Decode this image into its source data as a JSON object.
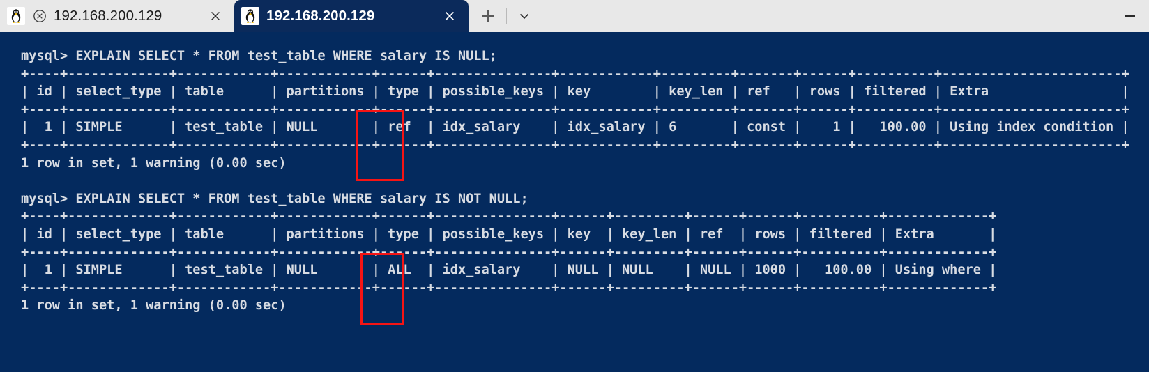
{
  "window": {
    "minimize_label": "Minimize"
  },
  "tabs": [
    {
      "title": "192.168.200.129",
      "active": false,
      "icon": "tux-penguin-icon",
      "status_icon": "circled-x-icon",
      "close_label": "Close tab"
    },
    {
      "title": "192.168.200.129",
      "active": true,
      "icon": "tux-penguin-icon",
      "close_label": "Close tab"
    }
  ],
  "tabbar": {
    "new_tab_label": "New tab",
    "dropdown_label": "Open a new tab dropdown"
  },
  "colors": {
    "terminal_background": "#042a5e",
    "terminal_text": "#d8dce3",
    "active_tab": "#0b2a5b",
    "titlebar": "#e8e8e8",
    "highlight_box": "#f61414"
  },
  "terminal": {
    "lines": [
      "mysql> EXPLAIN SELECT * FROM test_table WHERE salary IS NULL;",
      "+----+-------------+------------+------------+------+---------------+------------+---------+-------+------+----------+-----------------------+",
      "| id | select_type | table      | partitions | type | possible_keys | key        | key_len | ref   | rows | filtered | Extra                 |",
      "+----+-------------+------------+------------+------+---------------+------------+---------+-------+------+----------+-----------------------+",
      "|  1 | SIMPLE      | test_table | NULL       | ref  | idx_salary    | idx_salary | 6       | const |    1 |   100.00 | Using index condition |",
      "+----+-------------+------------+------------+------+---------------+------------+---------+-------+------+----------+-----------------------+",
      "1 row in set, 1 warning (0.00 sec)",
      "",
      "mysql> EXPLAIN SELECT * FROM test_table WHERE salary IS NOT NULL;",
      "+----+-------------+------------+------------+------+---------------+------+---------+------+------+----------+-------------+",
      "| id | select_type | table      | partitions | type | possible_keys | key  | key_len | ref  | rows | filtered | Extra       |",
      "+----+-------------+------------+------------+------+---------------+------+---------+------+------+----------+-------------+",
      "|  1 | SIMPLE      | test_table | NULL       | ALL  | idx_salary    | NULL | NULL    | NULL | 1000 |   100.00 | Using where |",
      "+----+-------------+------------+------------+------+---------------+------+---------+------+------+----------+-------------+",
      "1 row in set, 1 warning (0.00 sec)"
    ],
    "highlights": [
      {
        "name": "type-column-highlight-query-1",
        "column": "type",
        "value": "ref"
      },
      {
        "name": "type-column-highlight-query-2",
        "column": "type",
        "value": "ALL"
      }
    ],
    "queries": [
      {
        "prompt": "mysql>",
        "sql": "EXPLAIN SELECT * FROM test_table WHERE salary IS NULL;",
        "columns": [
          "id",
          "select_type",
          "table",
          "partitions",
          "type",
          "possible_keys",
          "key",
          "key_len",
          "ref",
          "rows",
          "filtered",
          "Extra"
        ],
        "rows": [
          [
            "1",
            "SIMPLE",
            "test_table",
            "NULL",
            "ref",
            "idx_salary",
            "idx_salary",
            "6",
            "const",
            "1",
            "100.00",
            "Using index condition"
          ]
        ],
        "status": "1 row in set, 1 warning (0.00 sec)"
      },
      {
        "prompt": "mysql>",
        "sql": "EXPLAIN SELECT * FROM test_table WHERE salary IS NOT NULL;",
        "columns": [
          "id",
          "select_type",
          "table",
          "partitions",
          "type",
          "possible_keys",
          "key",
          "key_len",
          "ref",
          "rows",
          "filtered",
          "Extra"
        ],
        "rows": [
          [
            "1",
            "SIMPLE",
            "test_table",
            "NULL",
            "ALL",
            "idx_salary",
            "NULL",
            "NULL",
            "NULL",
            "1000",
            "100.00",
            "Using where"
          ]
        ],
        "status": "1 row in set, 1 warning (0.00 sec)"
      }
    ]
  }
}
